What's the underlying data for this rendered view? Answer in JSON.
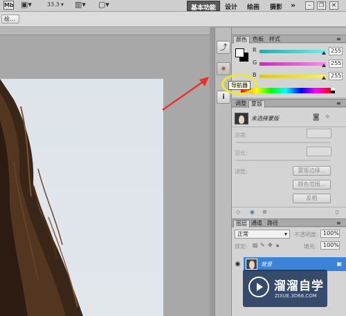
{
  "app_bar": {
    "app_icon": "Mb",
    "zoom": "33.3",
    "workspaces": [
      "基本功能",
      "设计",
      "绘画",
      "摄影"
    ],
    "overflow": "»"
  },
  "options_bar": {
    "button_label": "绘..."
  },
  "dock": {
    "tooltip": "导航器"
  },
  "color_panel": {
    "tabs": [
      "颜色",
      "色板",
      "样式"
    ],
    "channels": [
      {
        "label": "R",
        "value": "255",
        "color": "#28c8c8"
      },
      {
        "label": "G",
        "value": "255",
        "color": "#e040c8"
      },
      {
        "label": "B",
        "value": "255",
        "color": "#e8e030"
      }
    ],
    "foreground": "#ffffff",
    "background": "#000000"
  },
  "masks_panel": {
    "tabs": [
      "调整",
      "蒙版"
    ],
    "title": "未选择蒙版",
    "density_label": "浓度:",
    "feather_label": "羽化:",
    "refine_label": "调整:",
    "buttons": [
      "蒙版边缘...",
      "颜色范围...",
      "反相"
    ]
  },
  "layers_panel": {
    "tabs": [
      "图层",
      "通道",
      "路径"
    ],
    "blend_mode": "正常",
    "opacity_label": "不透明度:",
    "opacity": "100%",
    "lock_label": "锁定:",
    "fill_label": "填充:",
    "fill": "100%",
    "layer_name": "背景"
  },
  "watermark": {
    "title": "溜溜自学",
    "subtitle": "ZIXUE.3D66.COM"
  }
}
